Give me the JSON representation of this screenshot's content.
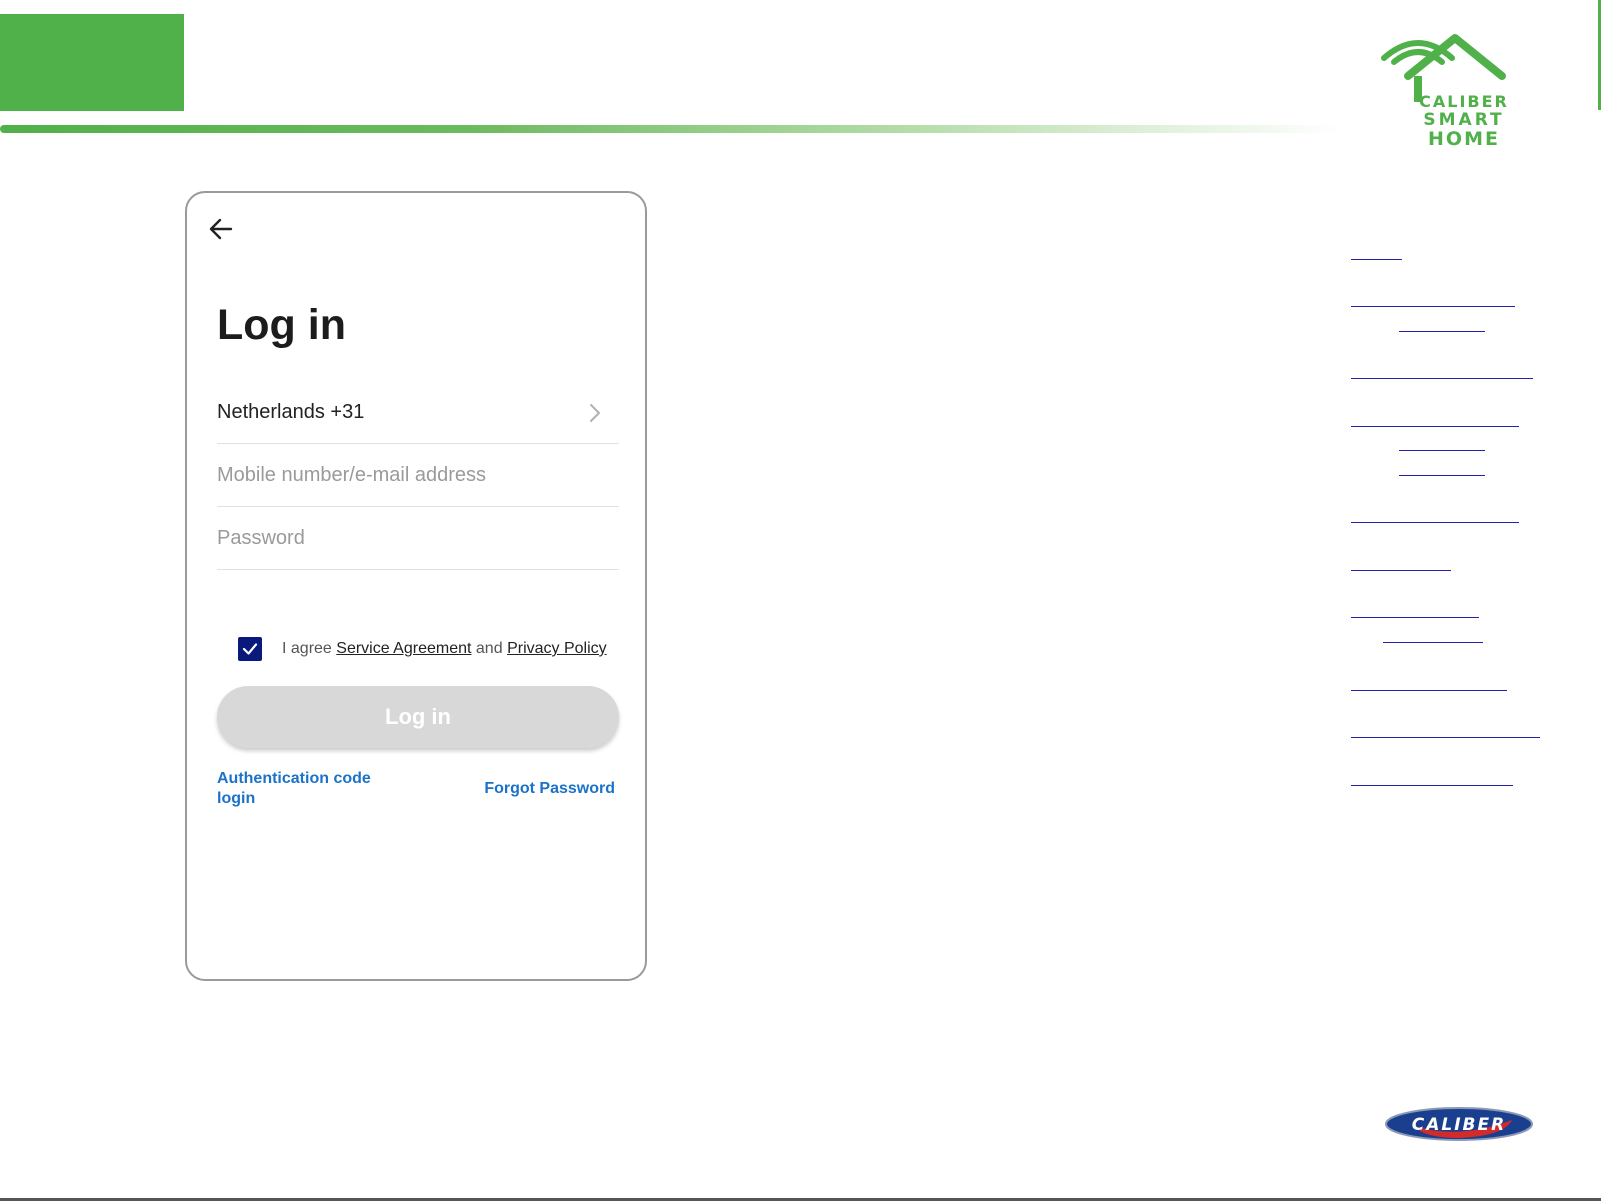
{
  "brand": {
    "logo_lines": [
      "CALIBER",
      "SMART",
      "HOME"
    ],
    "caliber_logo_text": "CALIBER",
    "accent_color": "#50b04a"
  },
  "login": {
    "title": "Log in",
    "country_label": "Netherlands +31",
    "account_placeholder": "Mobile number/e-mail address",
    "password_placeholder": "Password",
    "agree": {
      "checked": true,
      "prefix": "I agree",
      "service_agreement": "Service Agreement",
      "and": "and",
      "privacy_policy": "Privacy Policy"
    },
    "submit_label": "Log in",
    "auth_code_link": "Authentication code login",
    "forgot_password_link": "Forgot Password"
  },
  "icons": {
    "back": "arrow-left-icon",
    "country_chevron": "chevron-right-icon",
    "checkbox": "checkmark-icon"
  },
  "colors": {
    "link_blue": "#1a73c8",
    "checkbox_navy": "#0a1a7a",
    "button_disabled": "#d8d8d8"
  }
}
